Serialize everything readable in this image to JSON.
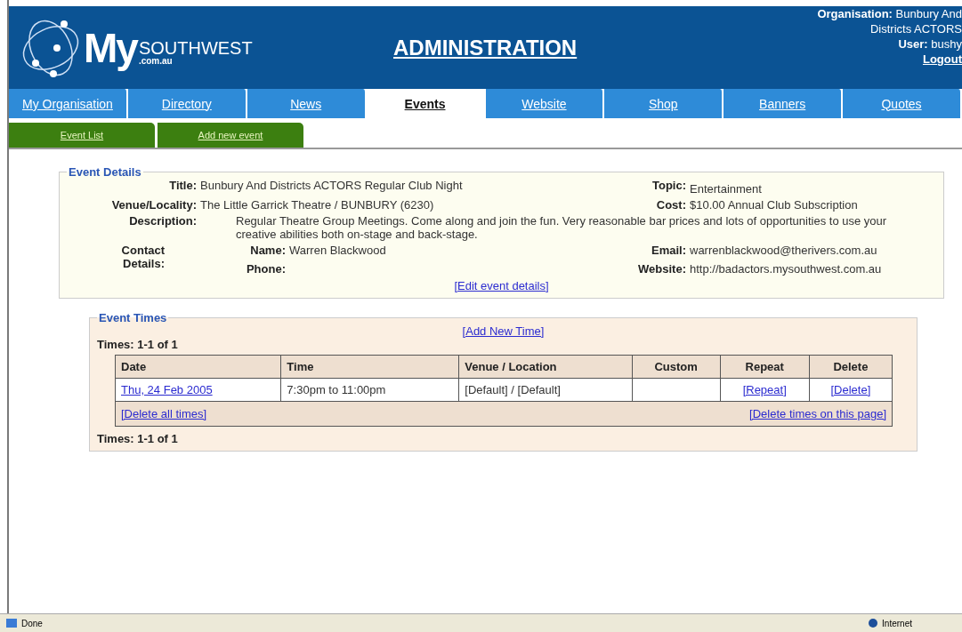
{
  "header": {
    "logo_main": "My",
    "logo_word": "SOUTHWEST",
    "logo_domain": ".com.au",
    "title": "ADMINISTRATION",
    "organisation_label": "Organisation:",
    "organisation": "Bunbury And Districts ACTORS",
    "user_label": "User:",
    "user": "bushy",
    "logout": "Logout"
  },
  "tabs": [
    {
      "label": "My Organisation",
      "selected": false
    },
    {
      "label": "Directory",
      "selected": false
    },
    {
      "label": "News",
      "selected": false
    },
    {
      "label": "Events",
      "selected": true
    },
    {
      "label": "Website",
      "selected": false
    },
    {
      "label": "Shop",
      "selected": false
    },
    {
      "label": "Banners",
      "selected": false
    },
    {
      "label": "Quotes",
      "selected": false
    }
  ],
  "subtabs": [
    {
      "label": "Event List"
    },
    {
      "label": "Add new event"
    }
  ],
  "event_details": {
    "legend": "Event Details",
    "title_label": "Title:",
    "title": "Bunbury And Districts ACTORS Regular Club Night",
    "topic_label": "Topic:",
    "topic": "Entertainment",
    "venue_label": "Venue/Locality:",
    "venue": "The Little Garrick Theatre / BUNBURY (6230)",
    "cost_label": "Cost:",
    "cost": "$10.00 Annual Club Subscription",
    "description_label": "Description:",
    "description": "Regular Theatre Group Meetings.  Come along and join the fun.  Very reasonable bar prices and lots of opportunities to use your creative abilities both on-stage and back-stage.",
    "contact_label": "Contact Details:",
    "name_label": "Name:",
    "name": "Warren Blackwood",
    "email_label": "Email:",
    "email": "warrenblackwood@therivers.com.au",
    "phone_label": "Phone:",
    "website_label": "Website:",
    "website": "http://badactors.mysouthwest.com.au",
    "edit_link": "[Edit event details]"
  },
  "event_times": {
    "legend": "Event Times",
    "add_link": "[Add New Time]",
    "count_top": "Times: 1-1 of 1",
    "columns": [
      "Date",
      "Time",
      "Venue / Location",
      "Custom",
      "Repeat",
      "Delete"
    ],
    "rows": [
      {
        "date": "Thu, 24 Feb 2005",
        "time": "7:30pm to 11:00pm",
        "venue": "[Default] / [Default]",
        "repeat": "[Repeat]",
        "delete": "[Delete]"
      }
    ],
    "delete_all": "[Delete all times]",
    "delete_page": "[Delete times on this page]",
    "count_bottom": "Times: 1-1 of 1"
  },
  "status_bar": {
    "status": "Done",
    "zone": "Internet"
  }
}
